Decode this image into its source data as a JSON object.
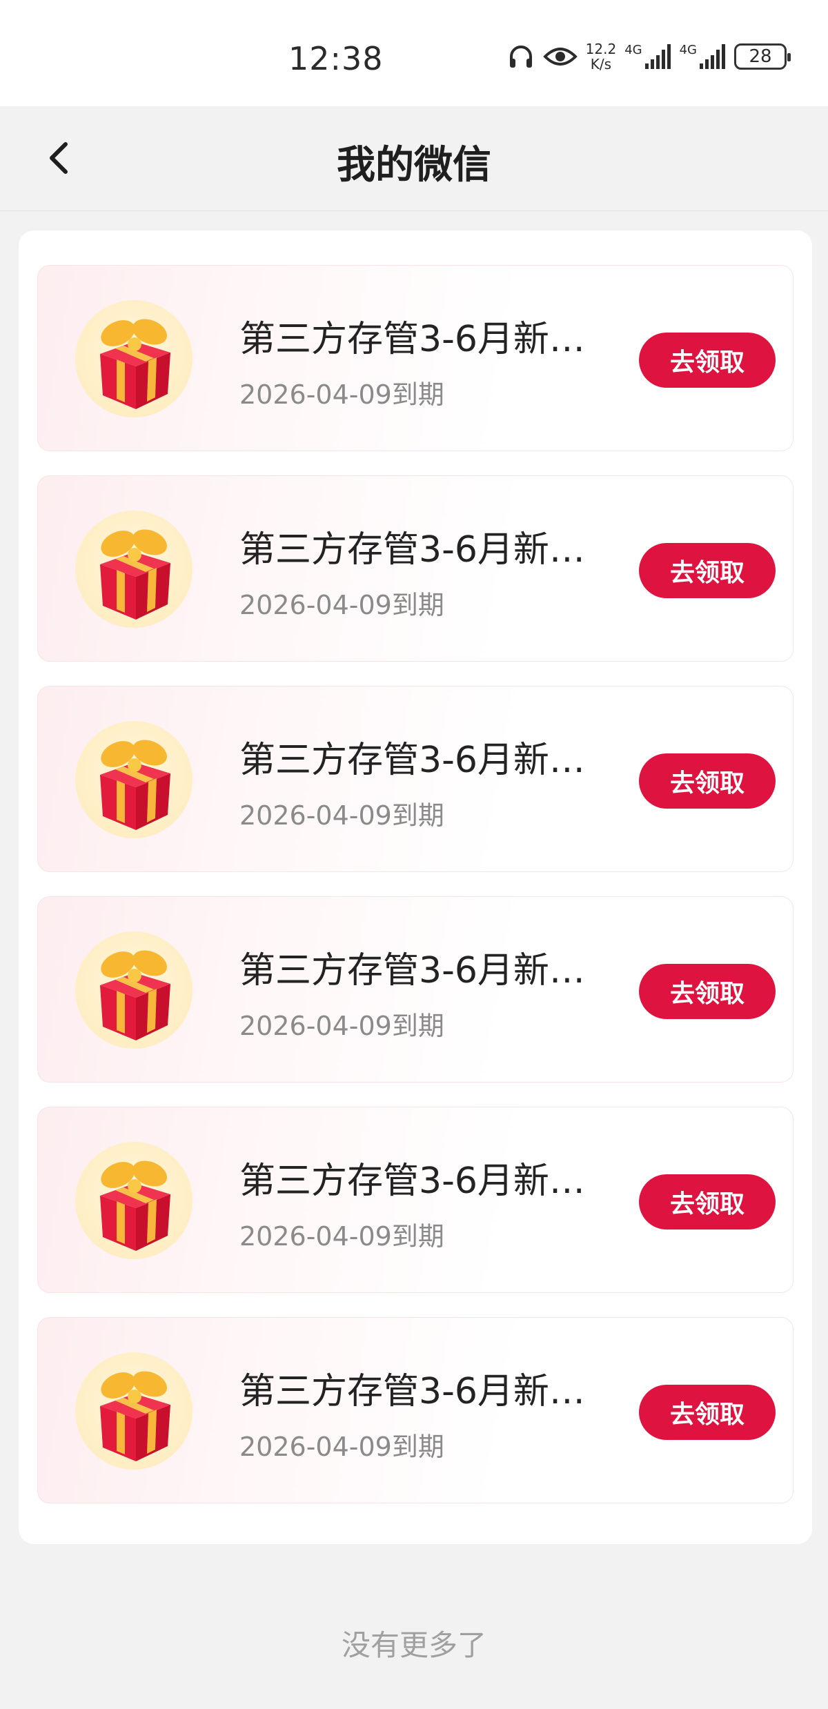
{
  "status_bar": {
    "time": "12:38",
    "net_speed_value": "12.2",
    "net_speed_unit": "K/s",
    "signal_1_label": "4G",
    "signal_2_label": "4G",
    "battery": "28",
    "icons": [
      "headphones-icon",
      "eye-icon",
      "signal-icon",
      "signal-icon",
      "battery-icon"
    ]
  },
  "nav": {
    "title": "我的微信",
    "back_icon": "chevron-left-icon"
  },
  "gifts": [
    {
      "title": "第三方存管3-6月新…",
      "date": "2026-04-09到期",
      "button": "去领取"
    },
    {
      "title": "第三方存管3-6月新…",
      "date": "2026-04-09到期",
      "button": "去领取"
    },
    {
      "title": "第三方存管3-6月新…",
      "date": "2026-04-09到期",
      "button": "去领取"
    },
    {
      "title": "第三方存管3-6月新…",
      "date": "2026-04-09到期",
      "button": "去领取"
    },
    {
      "title": "第三方存管3-6月新…",
      "date": "2026-04-09到期",
      "button": "去领取"
    },
    {
      "title": "第三方存管3-6月新…",
      "date": "2026-04-09到期",
      "button": "去领取"
    }
  ],
  "footer": {
    "no_more": "没有更多了"
  },
  "colors": {
    "accent": "#df1340",
    "background": "#f2f2f2",
    "card": "#ffffff",
    "gift_red": "#e8213f",
    "gift_ribbon": "#f6b73c"
  }
}
